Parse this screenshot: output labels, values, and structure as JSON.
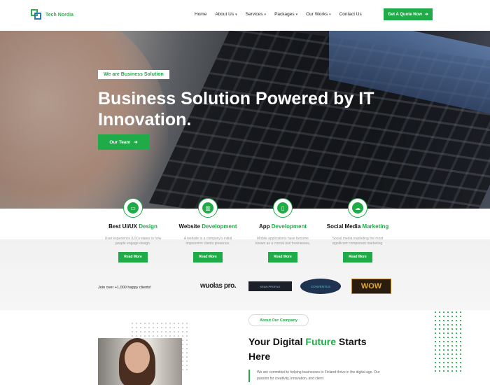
{
  "header": {
    "brand": "Tech Nordia",
    "nav": [
      {
        "label": "Home",
        "has_caret": false
      },
      {
        "label": "About Us",
        "has_caret": true
      },
      {
        "label": "Services",
        "has_caret": true
      },
      {
        "label": "Packages",
        "has_caret": true
      },
      {
        "label": "Our Works",
        "has_caret": true
      },
      {
        "label": "Contact Us",
        "has_caret": false
      }
    ],
    "cta_label": "Get A Quote Now"
  },
  "hero": {
    "badge": "We are Business Solution",
    "title": "Business Solution Powered by IT Innovation.",
    "button_label": "Our Team"
  },
  "services": [
    {
      "title_plain": "Best UI/UX ",
      "title_highlight": "Design",
      "desc": "User experience (UX) relates to how people engage design.",
      "button": "Read More",
      "icon": "monitor-icon"
    },
    {
      "title_plain": "Website ",
      "title_highlight": "Development",
      "desc": "A website is a company's initial impression clients presence.",
      "button": "Read More",
      "icon": "building-icon"
    },
    {
      "title_plain": "App ",
      "title_highlight": "Development",
      "desc": "Mobile applications have become known as a crucial tool businesses.",
      "button": "Read More",
      "icon": "mobile-icon"
    },
    {
      "title_plain": "Social Media ",
      "title_highlight": "Marketing",
      "desc": "Social media marketing the most significant component marketing.",
      "button": "Read More",
      "icon": "network-icon"
    }
  ],
  "clients": {
    "text": "Join over +1,000 happy clients!",
    "logos": [
      "wuolas pro.",
      "KEAN PROFILE",
      "CONVENTUS",
      "WOW"
    ]
  },
  "about": {
    "pill": "About Our Company",
    "title_1": "Your Digital ",
    "title_highlight": "Future",
    "title_2": " Starts Here",
    "text": "We are committed to helping businesses in Finland thrive in the digital age. Our passion for creativity, innovation, and client"
  },
  "colors": {
    "accent": "#1fab48",
    "dark": "#111111"
  }
}
